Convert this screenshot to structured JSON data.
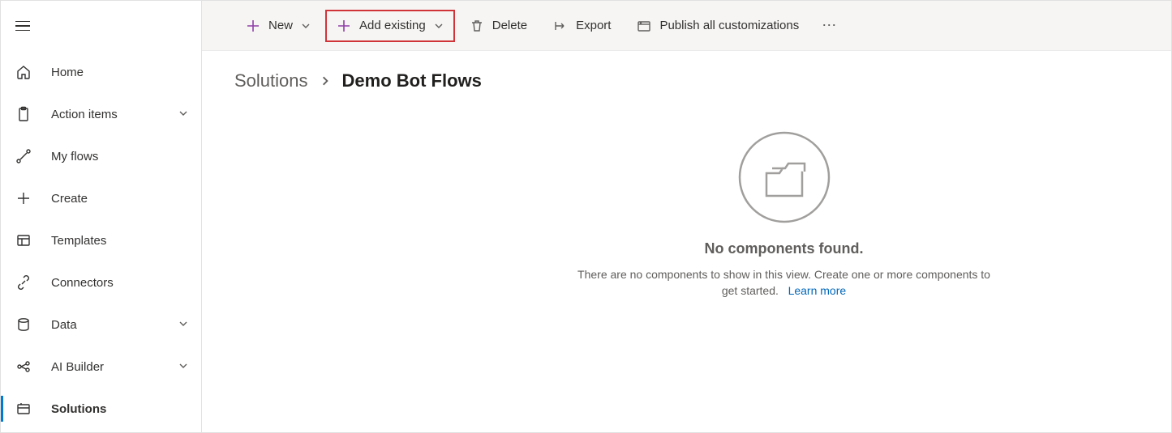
{
  "sidebar": {
    "items": [
      {
        "label": "Home",
        "icon": "home-icon",
        "expandable": false,
        "active": false
      },
      {
        "label": "Action items",
        "icon": "clipboard-icon",
        "expandable": true,
        "active": false
      },
      {
        "label": "My flows",
        "icon": "flow-icon",
        "expandable": false,
        "active": false
      },
      {
        "label": "Create",
        "icon": "plus-icon",
        "expandable": false,
        "active": false
      },
      {
        "label": "Templates",
        "icon": "template-icon",
        "expandable": false,
        "active": false
      },
      {
        "label": "Connectors",
        "icon": "connector-icon",
        "expandable": false,
        "active": false
      },
      {
        "label": "Data",
        "icon": "database-icon",
        "expandable": true,
        "active": false
      },
      {
        "label": "AI Builder",
        "icon": "ai-icon",
        "expandable": true,
        "active": false
      },
      {
        "label": "Solutions",
        "icon": "solutions-icon",
        "expandable": false,
        "active": true
      }
    ]
  },
  "toolbar": {
    "new_label": "New",
    "add_existing_label": "Add existing",
    "delete_label": "Delete",
    "export_label": "Export",
    "publish_label": "Publish all customizations"
  },
  "breadcrumb": {
    "root": "Solutions",
    "current": "Demo Bot Flows"
  },
  "empty": {
    "title": "No components found.",
    "text": "There are no components to show in this view. Create one or more components to get started.",
    "link": "Learn more"
  }
}
